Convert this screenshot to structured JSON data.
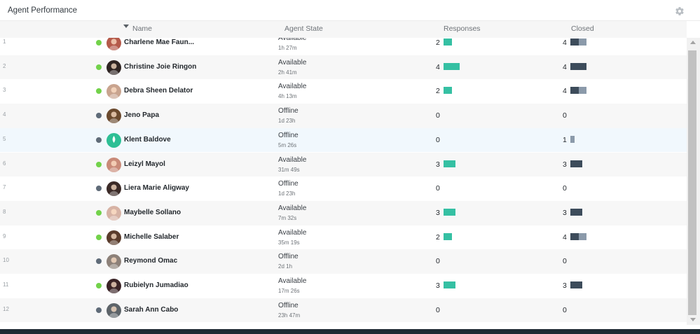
{
  "panel": {
    "title": "Agent Performance",
    "settings_icon": "gear-icon"
  },
  "columns": {
    "name": "Name",
    "state": "Agent State",
    "responses": "Responses",
    "closed": "Closed",
    "sort_icon": "sort-desc-icon"
  },
  "colors": {
    "available": "#72d24a",
    "offline": "#5f6b78",
    "responses_bar": "#35c0a3",
    "closed_dark": "#3d4c5b",
    "closed_light": "#8b9aaa"
  },
  "agents": [
    {
      "index": "1",
      "name": "Charlene Mae Faun...",
      "state": "Available",
      "duration": "1h 27m",
      "responses": "2",
      "closed": "4",
      "status": "available",
      "avatar_color": "#b55a4a"
    },
    {
      "index": "2",
      "name": "Christine Joie Ringon",
      "state": "Available",
      "duration": "2h 41m",
      "responses": "4",
      "closed": "4",
      "status": "available",
      "avatar_color": "#2e2422"
    },
    {
      "index": "3",
      "name": "Debra Sheen Delator",
      "state": "Available",
      "duration": "4h 13m",
      "responses": "2",
      "closed": "4",
      "status": "available",
      "avatar_color": "#c9a48f"
    },
    {
      "index": "4",
      "name": "Jeno Papa",
      "state": "Offline",
      "duration": "1d 23h",
      "responses": "0",
      "closed": "0",
      "status": "offline",
      "avatar_color": "#6b4a2e"
    },
    {
      "index": "5",
      "name": "Klent Baldove",
      "state": "Offline",
      "duration": "5m 26s",
      "responses": "0",
      "closed": "1",
      "status": "offline",
      "avatar_color": "#2dbf95"
    },
    {
      "index": "6",
      "name": "Leizyl Mayol",
      "state": "Available",
      "duration": "31m 49s",
      "responses": "3",
      "closed": "3",
      "status": "available",
      "avatar_color": "#c98a78"
    },
    {
      "index": "7",
      "name": "Liera Marie Aligway",
      "state": "Offline",
      "duration": "1d 23h",
      "responses": "0",
      "closed": "0",
      "status": "offline",
      "avatar_color": "#3b2a27"
    },
    {
      "index": "8",
      "name": "Maybelle Sollano",
      "state": "Available",
      "duration": "7m 32s",
      "responses": "3",
      "closed": "3",
      "status": "available",
      "avatar_color": "#d7b3a5"
    },
    {
      "index": "9",
      "name": "Michelle Salaber",
      "state": "Available",
      "duration": "35m 19s",
      "responses": "2",
      "closed": "4",
      "status": "available",
      "avatar_color": "#5a3c2c"
    },
    {
      "index": "10",
      "name": "Reymond Omac",
      "state": "Offline",
      "duration": "2d 1h",
      "responses": "0",
      "closed": "0",
      "status": "offline",
      "avatar_color": "#8d8179"
    },
    {
      "index": "11",
      "name": "Rubielyn Jumadiao",
      "state": "Available",
      "duration": "17m 26s",
      "responses": "3",
      "closed": "3",
      "status": "available",
      "avatar_color": "#3a2326"
    },
    {
      "index": "12",
      "name": "Sarah Ann Cabo",
      "state": "Offline",
      "duration": "23h 47m",
      "responses": "0",
      "closed": "0",
      "status": "offline",
      "avatar_color": "#5d6469"
    }
  ],
  "closed_breakdown": [
    {
      "dark": 2,
      "light": 2
    },
    {
      "dark": 4,
      "light": 0
    },
    {
      "dark": 2,
      "light": 2
    },
    {
      "dark": 0,
      "light": 0
    },
    {
      "dark": 0,
      "light": 1
    },
    {
      "dark": 3,
      "light": 0
    },
    {
      "dark": 0,
      "light": 0
    },
    {
      "dark": 3,
      "light": 0
    },
    {
      "dark": 2,
      "light": 2
    },
    {
      "dark": 0,
      "light": 0
    },
    {
      "dark": 3,
      "light": 0
    },
    {
      "dark": 0,
      "light": 0
    }
  ]
}
